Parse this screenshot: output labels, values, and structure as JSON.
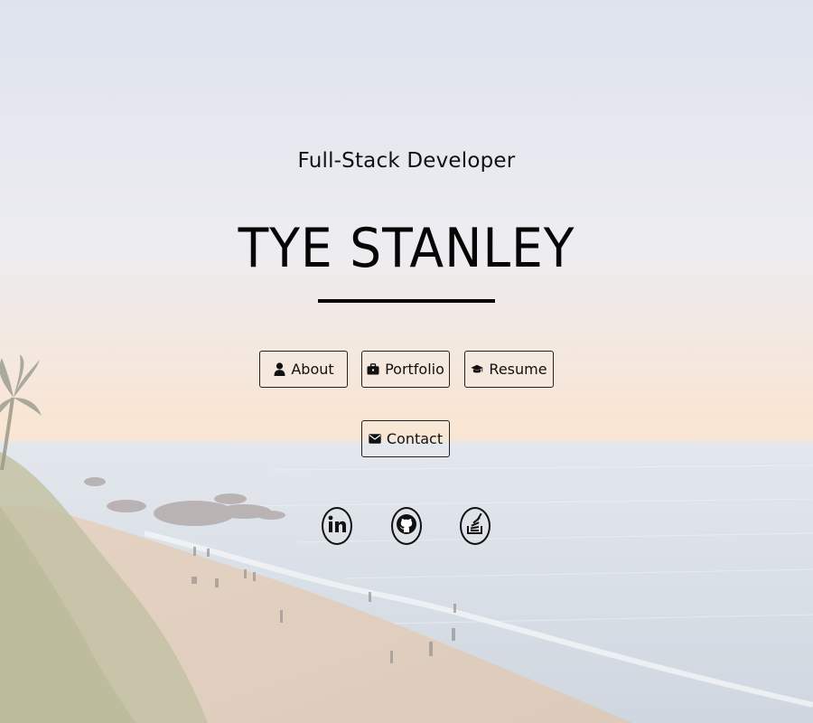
{
  "hero": {
    "subtitle": "Full-Stack Developer",
    "name": "TYE STANLEY"
  },
  "nav": {
    "about": {
      "label": "About",
      "icon": "user-icon"
    },
    "portfolio": {
      "label": "Portfolio",
      "icon": "briefcase-icon"
    },
    "resume": {
      "label": "Resume",
      "icon": "graduation-cap-icon"
    },
    "contact": {
      "label": "Contact",
      "icon": "envelope-icon"
    }
  },
  "social": [
    {
      "icon": "linkedin-icon"
    },
    {
      "icon": "github-icon"
    },
    {
      "icon": "stackoverflow-icon"
    }
  ],
  "colors": {
    "text": "#111111",
    "border": "#222222",
    "sky_top": "#d6dcea",
    "horizon": "#f7dcc0",
    "sea": "#c9d2dd",
    "sand": "#dcc4ad"
  }
}
